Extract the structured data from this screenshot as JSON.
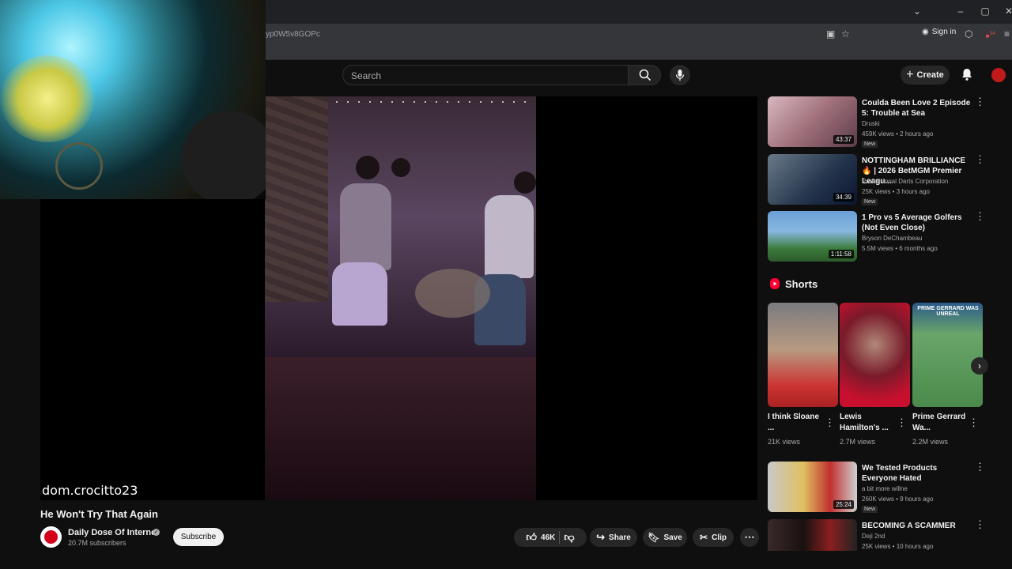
{
  "browser": {
    "url": "yp0W5v8GOPc",
    "sign_in": "Sign in",
    "ext_badge": "54"
  },
  "header": {
    "search_placeholder": "Search",
    "create_label": "Create"
  },
  "player": {
    "watermark": "dom.crocitto23"
  },
  "video": {
    "title": "He Won't Try That Again",
    "channel": "Daily Dose Of Internet",
    "subscribers": "20.7M subscribers",
    "subscribe_label": "Subscribe",
    "likes": "46K",
    "share_label": "Share",
    "save_label": "Save",
    "clip_label": "Clip"
  },
  "recommendations": [
    {
      "title": "Coulda Been Love 2 Episode 5: Trouble at Sea",
      "channel": "Druski",
      "meta": "459K views • 2 hours ago",
      "badge": "New",
      "duration": "43:37"
    },
    {
      "title": "NOTTINGHAM BRILLIANCE 🔥 | 2026 BetMGM Premier Leagu...",
      "channel": "Professional Darts Corporation",
      "meta": "25K views • 3 hours ago",
      "badge": "New",
      "duration": "34:39"
    },
    {
      "title": "1 Pro vs 5 Average Golfers (Not Even Close)",
      "channel": "Bryson DeChambeau",
      "meta": "5.5M views • 6 months ago",
      "badge": "",
      "duration": "1:11:58"
    }
  ],
  "shorts": {
    "heading": "Shorts",
    "items": [
      {
        "title": "I think Sloane ...",
        "views": "21K views"
      },
      {
        "title": "Lewis Hamilton's ...",
        "views": "2.7M views"
      },
      {
        "title": "Prime Gerrard Wa...",
        "views": "2.2M views",
        "overlay": "PRIME GERRARD WAS UNREAL"
      }
    ]
  },
  "recommendations_after": [
    {
      "title": "We Tested Products Everyone Hated",
      "channel": "a bit more willne",
      "meta": "260K views • 9 hours ago",
      "badge": "New",
      "duration": "25:24"
    },
    {
      "title": "BECOMING A SCAMMER",
      "channel": "Deji 2nd",
      "meta": "25K views • 10 hours ago",
      "badge": "",
      "duration": ""
    }
  ]
}
